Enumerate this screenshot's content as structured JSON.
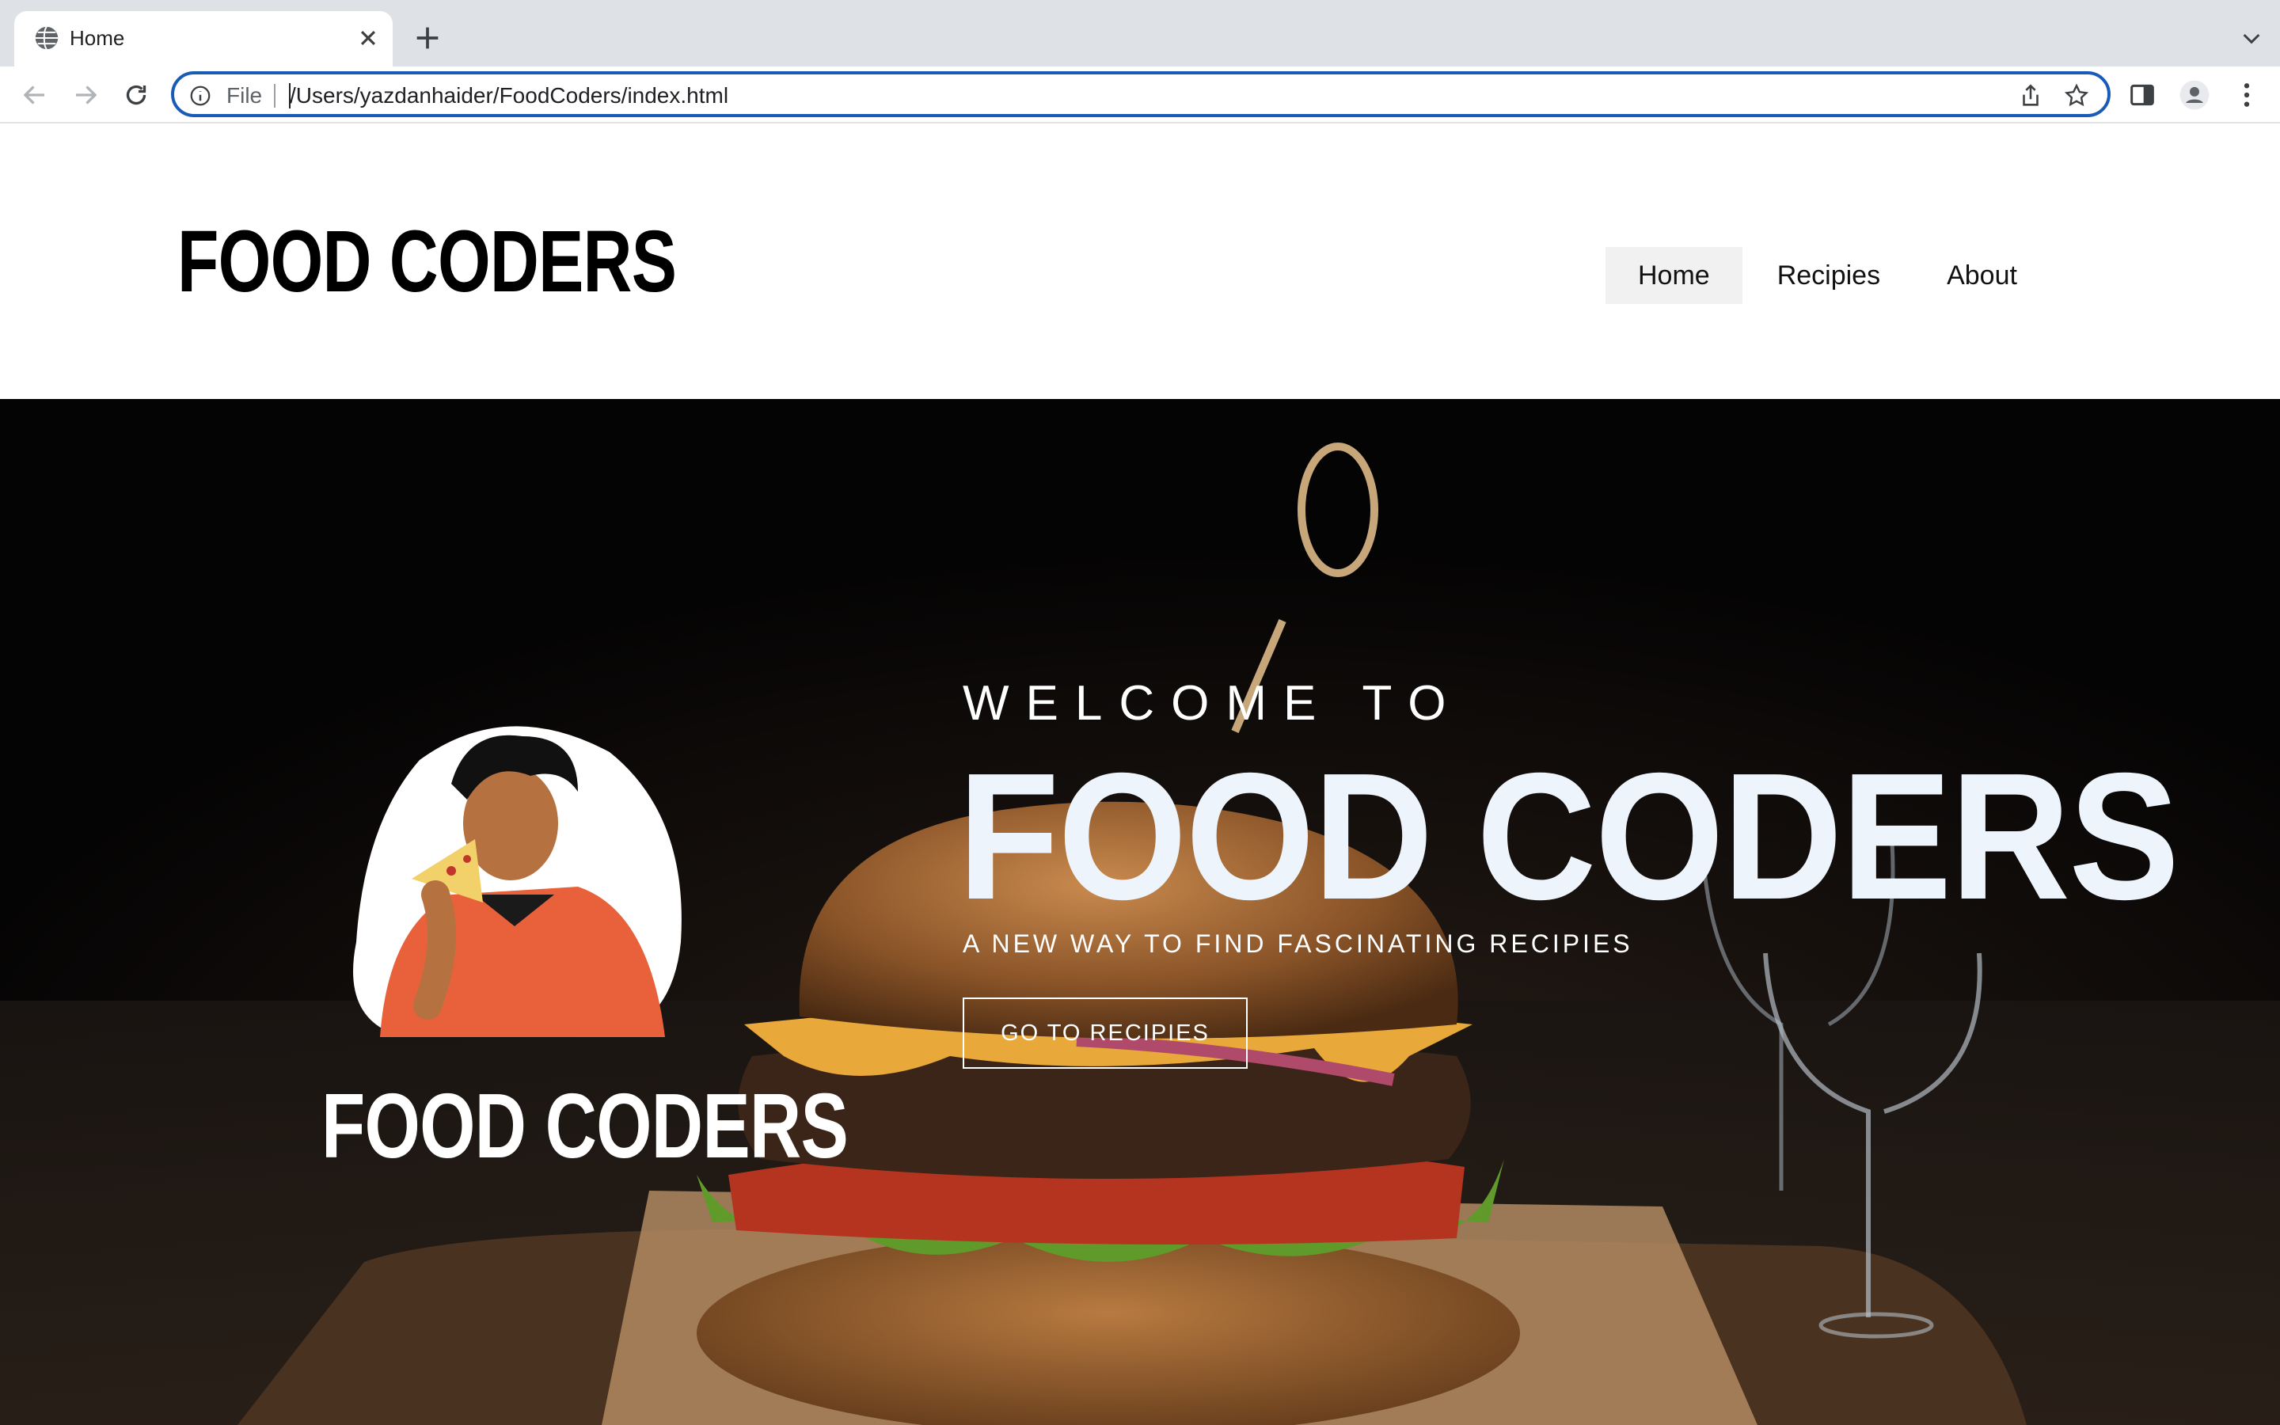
{
  "browser": {
    "tab_title": "Home",
    "omnibox": {
      "scheme_label": "File",
      "url": "/Users/yazdanhaider/FoodCoders/index.html"
    },
    "icons": [
      "globe-icon",
      "close-icon",
      "plus-icon",
      "chevron-down-icon",
      "back-arrow-icon",
      "forward-arrow-icon",
      "reload-icon",
      "info-icon",
      "share-icon",
      "star-icon",
      "side-panel-icon",
      "profile-icon",
      "kebab-menu-icon"
    ],
    "accent_color": "#1a5bb8"
  },
  "site": {
    "logo": "FOOD CODERS",
    "nav": [
      {
        "label": "Home",
        "active": true
      },
      {
        "label": "Recipies",
        "active": false
      },
      {
        "label": "About",
        "active": false
      }
    ]
  },
  "hero": {
    "mascot_name": "FOOD CODERS",
    "welcome": "WELCOME TO",
    "title": "FOOD CODERS",
    "tagline": "A NEW WAY TO FIND FASCINATING RECIPIES",
    "cta_label": "GO TO RECIPIES",
    "title_color": "#eef4fb",
    "mascot_shirt_color": "#e8613a"
  }
}
